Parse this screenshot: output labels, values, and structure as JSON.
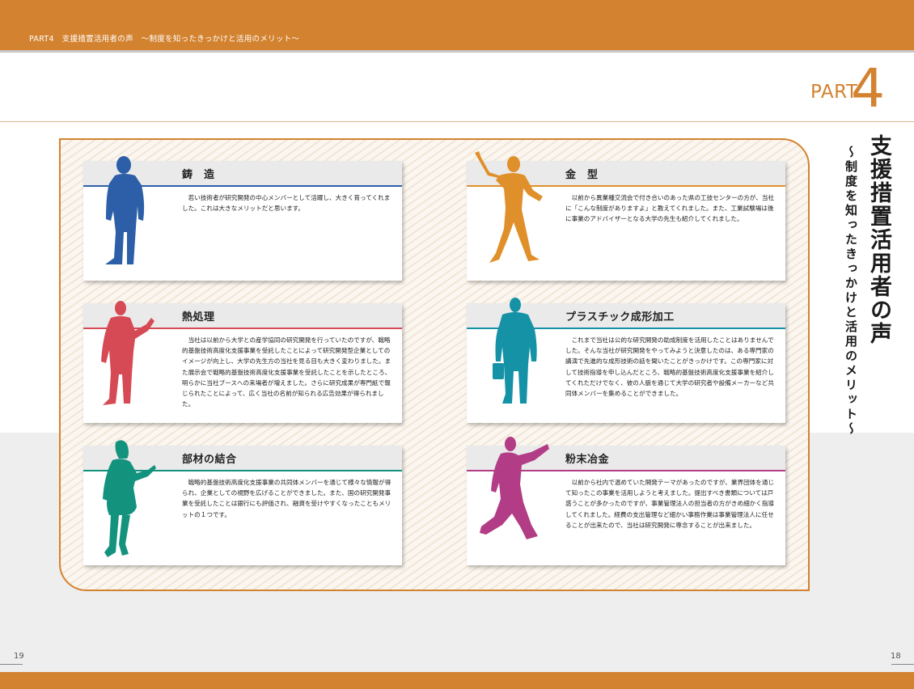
{
  "header": {
    "breadcrumb": "PART4　支援措置活用者の声　～制度を知ったきっかけと活用のメリット～"
  },
  "part": {
    "label": "PART",
    "number": "4"
  },
  "title": {
    "main": "支援措置活用者の声",
    "sub": "～制度を知ったきっかけと活用のメリット～"
  },
  "pages": {
    "left": "19",
    "right": "18"
  },
  "colors": {
    "accent": "#d3822f",
    "blue": "#2d5fa8",
    "orange": "#e0902a",
    "red": "#d64a55",
    "teal": "#1592a6",
    "green": "#13937e",
    "magenta": "#b23d86"
  },
  "cards": [
    {
      "title": "鋳　造",
      "icon": "standing-man-blue-icon",
      "text": "若い技術者が研究開発の中心メンバーとして活躍し、大きく育ってくれました。これは大きなメリットだと思います。"
    },
    {
      "title": "金　型",
      "icon": "waving-man-orange-icon",
      "text": "以前から異業種交流会で付き合いのあった県の工技センターの方が、当社に「こんな制度がありますよ」と教えてくれました。また、工業試験場は後に事業のアドバイザーとなる大学の先生も紹介してくれました。"
    },
    {
      "title": "熱処理",
      "icon": "presenting-man-red-icon",
      "text": "当社は以前から大学との産学協同の研究開発を行っていたのですが、戦略的基盤技術高度化支援事業を受託したことによって研究開発型企業としてのイメージが向上し、大学の先生方の当社を見る目も大きく変わりました。また展示会で戦略的基盤技術高度化支援事業を受託したことを示したところ、明らかに当社ブースへの来場者が増えました。さらに研究成果が専門紙で報じられたことによって、広く当社の名前が知られる広告効果が得られました。"
    },
    {
      "title": "プラスチック成形加工",
      "icon": "businessman-teal-icon",
      "text": "これまで当社は公的な研究開発の助成制度を活用したことはありませんでした。そんな当社が研究開発をやってみようと決意したのは、ある専門家の講演で先進的な成形技術の話を聞いたことがきっかけです。この専門家に対して技術指導を申し込んだところ、戦略的基盤技術高度化支援事業を紹介してくれただけでなく、彼の人脈を通じて大学の研究者や設備メーカーなど共同体メンバーを集めることができました。"
    },
    {
      "title": "部材の結合",
      "icon": "woman-green-icon",
      "text": "戦略的基盤技術高度化支援事業の共同体メンバーを通じて様々な情報が得られ、企業としての視野を広げることができました。また、国の研究開発事業を受託したことは銀行にも評価され、融資を受けやすくなったこともメリットの１つです。"
    },
    {
      "title": "粉末冶金",
      "icon": "walking-pointing-man-magenta-icon",
      "text": "以前から社内で温めていた開発テーマがあったのですが、業界団体を通じて知ったこの事業を活用しようと考えました。提出すべき書類については戸惑うことが多かったのですが、事業管理法人の担当者の方がきめ細かく指導してくれました。経費の支出管理など細かい事務作業は事業管理法人に任せることが出来たので、当社は研究開発に専念することが出来ました。"
    }
  ]
}
